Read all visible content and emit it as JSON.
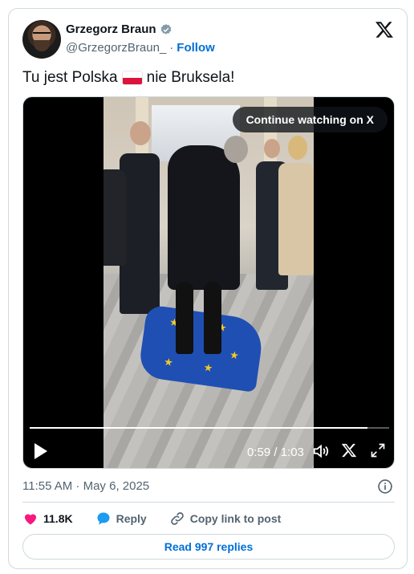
{
  "author": {
    "name": "Grzegorz Braun",
    "handle": "@GrzegorzBraun_",
    "separator": "·",
    "follow_label": "Follow"
  },
  "tweet": {
    "text_before": "Tu jest Polska",
    "text_after": "nie Bruksela!",
    "emoji": "polish-flag"
  },
  "video": {
    "continue_label": "Continue watching on X",
    "time": "0:59 / 1:03",
    "progress": 0.94
  },
  "timestamp": "11:55 AM · May 6, 2025",
  "actions": {
    "likes": "11.8K",
    "reply": "Reply",
    "copy_link": "Copy link to post"
  },
  "read_replies": "Read 997 replies",
  "colors": {
    "accent": "#006fd6",
    "like": "#f91880",
    "reply": "#1d9bf0",
    "border": "#cfd9de",
    "muted": "#536471"
  }
}
